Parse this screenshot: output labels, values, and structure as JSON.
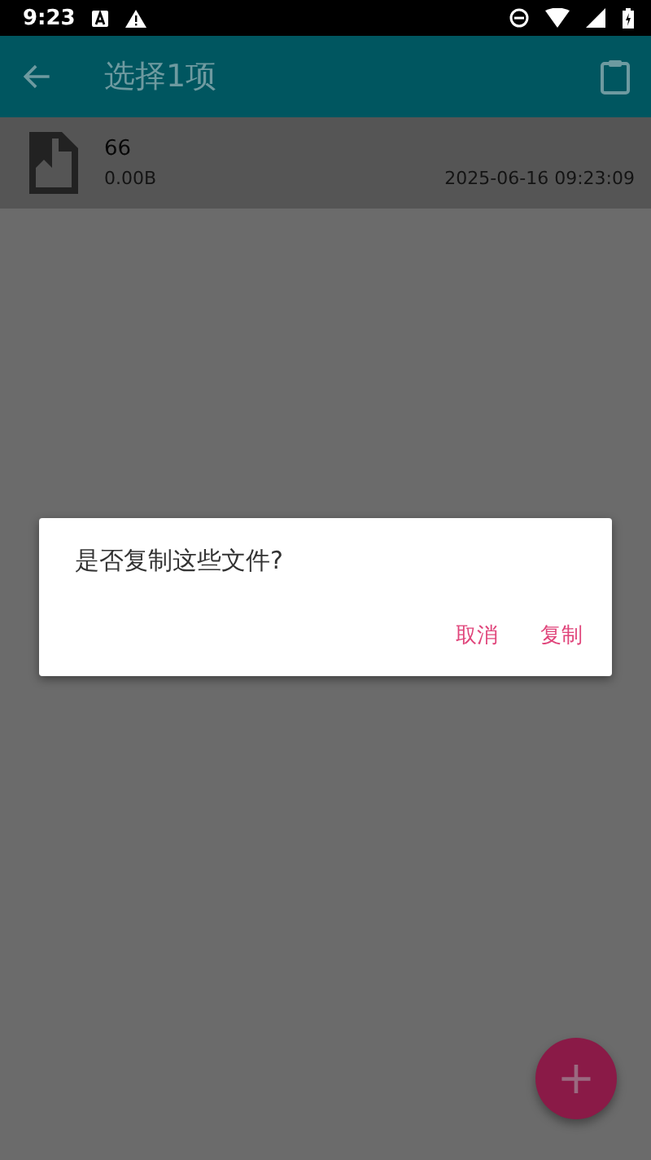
{
  "status_bar": {
    "time": "9:23"
  },
  "toolbar": {
    "title": "选择1项"
  },
  "files": [
    {
      "name": "66",
      "size": "0.00B",
      "modified": "2025-06-16 09:23:09",
      "selected": true
    }
  ],
  "dialog": {
    "message": "是否复制这些文件?",
    "buttons": [
      "取消",
      "复制"
    ]
  },
  "fab": {
    "label": "+"
  }
}
